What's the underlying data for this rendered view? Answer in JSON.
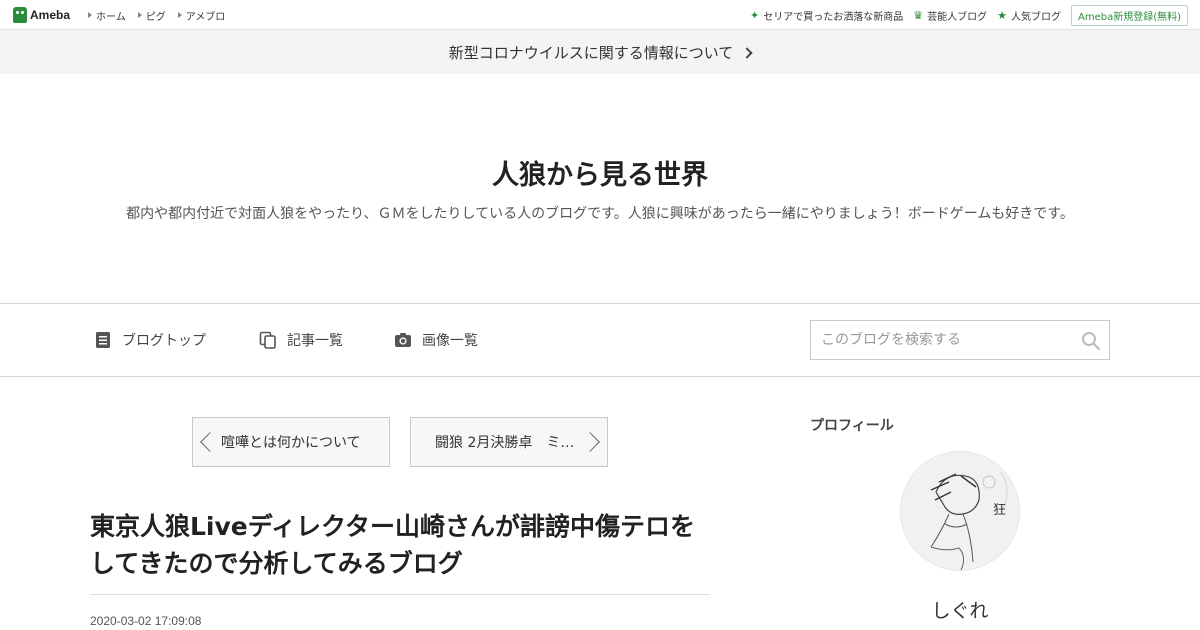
{
  "topbar": {
    "logo_text": "Ameba",
    "nav": [
      "ホーム",
      "ピグ",
      "アメブロ"
    ],
    "right_links": [
      {
        "icon": "sparkle-icon",
        "label": "セリアで買ったお洒落な新商品"
      },
      {
        "icon": "crown-icon",
        "label": "芸能人ブログ"
      },
      {
        "icon": "star-icon",
        "label": "人気ブログ"
      }
    ],
    "register_label": "Ameba新規登録(無料)"
  },
  "notice": {
    "text": "新型コロナウイルスに関する情報について"
  },
  "header": {
    "title": "人狼から見る世界",
    "description": "都内や都内付近で対面人狼をやったり、ＧＭをしたりしている人のブログです。人狼に興味があったら一緒にやりましょう！ボードゲームも好きです。"
  },
  "nav": {
    "items": [
      {
        "icon": "document-icon",
        "label": "ブログトップ"
      },
      {
        "icon": "copy-icon",
        "label": "記事一覧"
      },
      {
        "icon": "camera-icon",
        "label": "画像一覧"
      }
    ],
    "search_placeholder": "このブログを検索する"
  },
  "pager": {
    "prev_label": "喧嘩とは何かについて",
    "next_label": "闘狼 2月決勝卓　ミ…"
  },
  "article": {
    "title": "東京人狼Liveディレクター山崎さんが誹謗中傷テロをしてきたので分析してみるブログ",
    "date": "2020-03-02 17:09:08"
  },
  "profile": {
    "heading": "プロフィール",
    "name": "しぐれ",
    "avatar_mark": "狂"
  },
  "colors": {
    "brand_green": "#2d8c3c",
    "notice_bg": "#f4f4f4"
  }
}
